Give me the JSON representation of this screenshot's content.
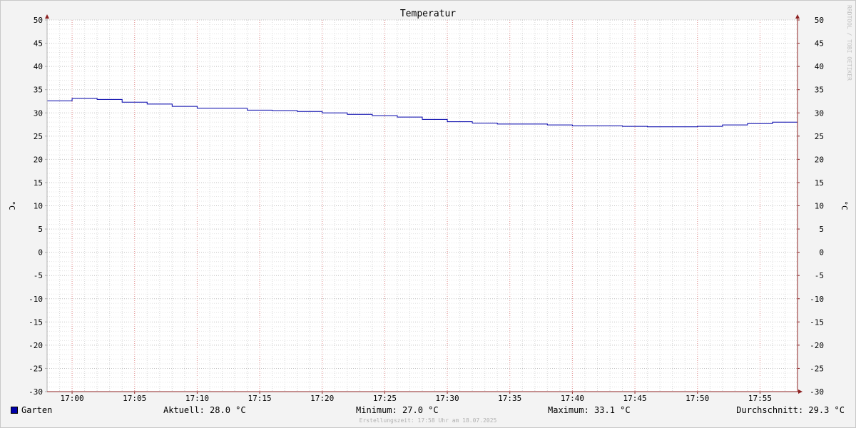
{
  "chart_data": {
    "type": "line",
    "title": "Temperatur",
    "ylabel": "°C",
    "ylabel_right": "°C",
    "ylim": [
      -30,
      50
    ],
    "y_ticks": [
      50,
      45,
      40,
      35,
      30,
      25,
      20,
      15,
      10,
      5,
      0,
      -5,
      -10,
      -15,
      -20,
      -25,
      -30
    ],
    "xlim": [
      "16:58",
      "17:58"
    ],
    "x_ticks": [
      "17:00",
      "17:05",
      "17:10",
      "17:15",
      "17:20",
      "17:25",
      "17:30",
      "17:35",
      "17:40",
      "17:45",
      "17:50",
      "17:55"
    ],
    "grid": true,
    "watermark": "RRDTOOL / TOBI OETIKER",
    "series": [
      {
        "name": "Garten",
        "color": "#0000aa",
        "line_shape": "step",
        "points": [
          [
            "16:58",
            32.6
          ],
          [
            "17:00",
            33.1
          ],
          [
            "17:02",
            32.9
          ],
          [
            "17:04",
            32.3
          ],
          [
            "17:06",
            31.9
          ],
          [
            "17:08",
            31.4
          ],
          [
            "17:10",
            31.0
          ],
          [
            "17:14",
            30.6
          ],
          [
            "17:16",
            30.5
          ],
          [
            "17:18",
            30.3
          ],
          [
            "17:20",
            30.0
          ],
          [
            "17:22",
            29.7
          ],
          [
            "17:24",
            29.4
          ],
          [
            "17:26",
            29.1
          ],
          [
            "17:28",
            28.6
          ],
          [
            "17:30",
            28.1
          ],
          [
            "17:32",
            27.8
          ],
          [
            "17:34",
            27.6
          ],
          [
            "17:38",
            27.4
          ],
          [
            "17:40",
            27.2
          ],
          [
            "17:44",
            27.1
          ],
          [
            "17:46",
            27.0
          ],
          [
            "17:50",
            27.1
          ],
          [
            "17:52",
            27.4
          ],
          [
            "17:54",
            27.7
          ],
          [
            "17:56",
            28.0
          ],
          [
            "17:58",
            28.0
          ]
        ]
      }
    ]
  },
  "legend": {
    "series_name": "Garten",
    "current": "Aktuell: 28.0 °C",
    "minimum": "Minimum: 27.0 °C",
    "maximum": "Maximum: 33.1 °C",
    "average": "Durchschnitt: 29.3 °C"
  },
  "footer": {
    "created": "Erstellungszeit: 17:58 Uhr am 18.07.2025"
  }
}
